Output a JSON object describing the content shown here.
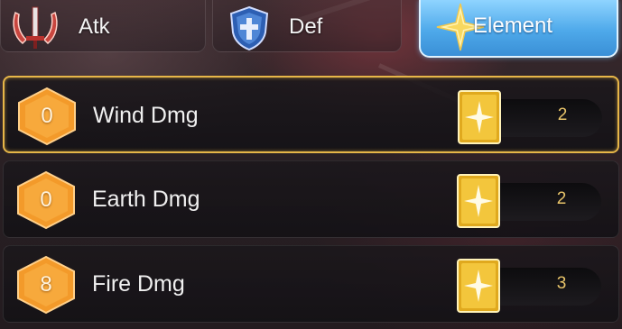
{
  "tabs": [
    {
      "label": "Atk",
      "icon": "crossed-swords-icon",
      "active": false
    },
    {
      "label": "Def",
      "icon": "shield-cross-icon",
      "active": false
    },
    {
      "label": "Element",
      "icon": "four-point-star-icon",
      "active": true
    }
  ],
  "rows": [
    {
      "level": "0",
      "label": "Wind Dmg",
      "count": "2",
      "selected": true,
      "card_icon": "star-card-icon"
    },
    {
      "level": "0",
      "label": "Earth Dmg",
      "count": "2",
      "selected": false,
      "card_icon": "star-card-icon"
    },
    {
      "level": "8",
      "label": "Fire Dmg",
      "count": "3",
      "selected": false,
      "card_icon": "star-card-icon"
    }
  ],
  "colors": {
    "active_tab": "#4ea9ea",
    "selected_border": "#e7b648",
    "hex_badge": "#f39a2a",
    "count_text": "#e9c56a",
    "card_gold": "#f1c232"
  }
}
